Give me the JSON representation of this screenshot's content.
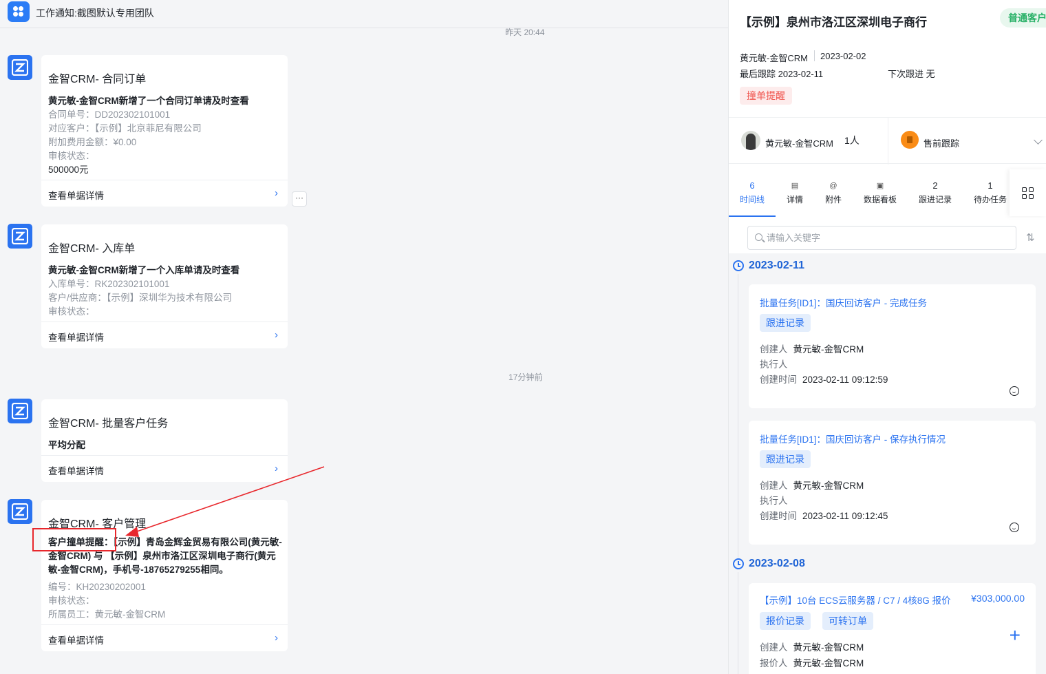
{
  "topbar": {
    "title": "工作通知:截图默认专用团队",
    "icon": "app-grid-icon"
  },
  "timestamps": [
    "昨天 20:44",
    "17分钟前"
  ],
  "messages": [
    {
      "title": "金智CRM- 合同订单",
      "headline": "黄元敏-金智CRM新增了一个合同订单请及时查看",
      "lines": [
        "合同单号：DD202302101001",
        "对应客户：【示例】北京菲尼有限公司",
        "附加费用金额：¥0.00",
        "审核状态："
      ],
      "amount": "500000元",
      "footer": "查看单据详情"
    },
    {
      "title": "金智CRM- 入库单",
      "headline": "黄元敏-金智CRM新增了一个入库单请及时查看",
      "lines": [
        "入库单号：RK202302101001",
        "客户/供应商：【示例】深圳华为技术有限公司",
        "审核状态："
      ],
      "footer": "查看单据详情"
    },
    {
      "title": "金智CRM- 批量客户任务",
      "headline": "平均分配",
      "footer": "查看单据详情"
    },
    {
      "title": "金智CRM- 客户管理",
      "headline": "客户撞单提醒：【示例】青岛金辉金贸易有限公司(黄元敏-金智CRM) 与 【示例】泉州市洛江区深圳电子商行(黄元敏-金智CRM)，手机号-18765279255相同。",
      "lines": [
        "编号：KH20230202001",
        "审核状态：",
        "所属员工：黄元敏-金智CRM"
      ],
      "footer": "查看单据详情"
    }
  ],
  "more_button": "···",
  "detail": {
    "customer_name": "【示例】泉州市洛江区深圳电子商行",
    "customer_badge": "普通客户",
    "owner_line": "黄元敏-金智CRM",
    "created": "2023-02-02",
    "last_follow": "最后跟踪 2023-02-11",
    "next_follow": "下次跟进 无",
    "warning_tag": "撞单提醒",
    "owner_name": "黄元敏-金智CRM",
    "owner_count": "1人",
    "stage": "售前跟踪",
    "tabs": [
      {
        "top": "6",
        "label": "时间线",
        "active": true
      },
      {
        "top": "▤",
        "label": "详情"
      },
      {
        "top": "@",
        "label": "附件"
      },
      {
        "top": "▣",
        "label": "数据看板"
      },
      {
        "top": "2",
        "label": "跟进记录"
      },
      {
        "top": "1",
        "label": "待办任务"
      }
    ],
    "search_placeholder": "请输入关键字",
    "timeline": [
      {
        "date": "2023-02-11",
        "items": [
          {
            "title": "批量任务[ID1]：国庆回访客户 - 完成任务",
            "tags": [
              "跟进记录"
            ],
            "creator_label": "创建人",
            "creator": "黄元敏-金智CRM",
            "executor_label": "执行人",
            "time_label": "创建时间",
            "time": "2023-02-11 09:12:59"
          },
          {
            "title": "批量任务[ID1]：国庆回访客户 - 保存执行情况",
            "tags": [
              "跟进记录"
            ],
            "creator_label": "创建人",
            "creator": "黄元敏-金智CRM",
            "executor_label": "执行人",
            "time_label": "创建时间",
            "time": "2023-02-11 09:12:45"
          }
        ]
      },
      {
        "date": "2023-02-08",
        "items": [
          {
            "title": "【示例】10台 ECS云服务器 / C7 / 4核8G 报价",
            "amount": "¥303,000.00",
            "tags": [
              "报价记录",
              "可转订单"
            ],
            "creator_label": "创建人",
            "creator": "黄元敏-金智CRM",
            "quoter_label": "报价人",
            "quoter": "黄元敏-金智CRM"
          }
        ]
      }
    ]
  }
}
